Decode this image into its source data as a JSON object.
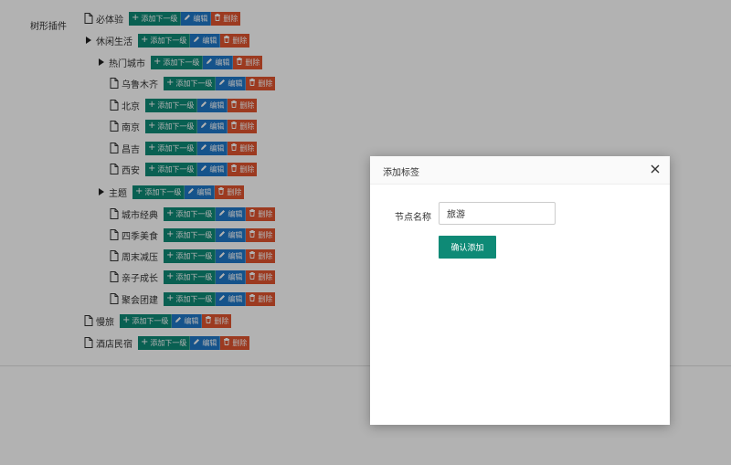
{
  "plugin_label": "树形插件",
  "buttons": {
    "add": "添加下一级",
    "edit": "编辑",
    "delete": "删除"
  },
  "tree": {
    "nodes": [
      {
        "label": "必体验",
        "type": "leaf"
      },
      {
        "label": "休闲生活",
        "type": "branch"
      },
      {
        "label": "热门城市",
        "type": "branch"
      },
      {
        "label": "乌鲁木齐",
        "type": "leaf"
      },
      {
        "label": "北京",
        "type": "leaf"
      },
      {
        "label": "南京",
        "type": "leaf"
      },
      {
        "label": "昌吉",
        "type": "leaf"
      },
      {
        "label": "西安",
        "type": "leaf"
      },
      {
        "label": "主题",
        "type": "branch"
      },
      {
        "label": "城市经典",
        "type": "leaf"
      },
      {
        "label": "四季美食",
        "type": "leaf"
      },
      {
        "label": "周末减压",
        "type": "leaf"
      },
      {
        "label": "亲子成长",
        "type": "leaf"
      },
      {
        "label": "聚会团建",
        "type": "leaf"
      },
      {
        "label": "慢旅",
        "type": "leaf"
      },
      {
        "label": "酒店民宿",
        "type": "leaf"
      }
    ]
  },
  "modal": {
    "title": "添加标签",
    "field_label": "节点名称",
    "field_value": "旅游",
    "confirm_label": "确认添加"
  },
  "colors": {
    "add": "#0e8a76",
    "edit": "#1f78c8",
    "delete": "#e0532e",
    "overlay": "rgba(0,0,0,0.3)"
  }
}
